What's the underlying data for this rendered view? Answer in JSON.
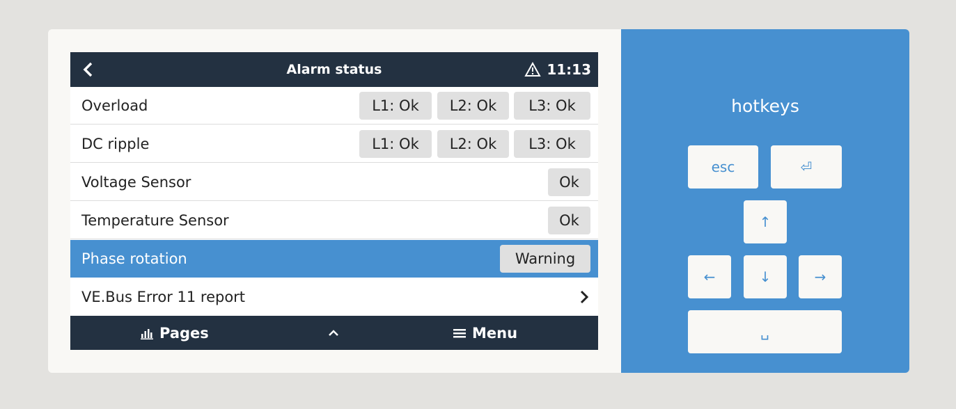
{
  "header": {
    "title": "Alarm status",
    "time": "11:13",
    "back_icon": "chevron-left-icon",
    "warning_icon": "warning-triangle-icon"
  },
  "rows": [
    {
      "label": "Overload",
      "pills": [
        "L1: Ok",
        "L2: Ok",
        "L3: Ok"
      ]
    },
    {
      "label": "DC ripple",
      "pills": [
        "L1: Ok",
        "L2: Ok",
        "L3: Ok"
      ]
    },
    {
      "label": "Voltage Sensor",
      "pills": [
        "Ok"
      ]
    },
    {
      "label": "Temperature Sensor",
      "pills": [
        "Ok"
      ]
    },
    {
      "label": "Phase rotation",
      "pills": [
        "Warning"
      ],
      "selected": true
    },
    {
      "label": "VE.Bus Error 11 report",
      "pills": [],
      "chevron": "chevron-right-icon"
    }
  ],
  "footer": {
    "pages_label": "Pages",
    "pages_icon": "bar-chart-icon",
    "up_icon": "chevron-up-icon",
    "menu_label": "Menu",
    "menu_icon": "hamburger-menu-icon"
  },
  "hotkeys": {
    "title": "hotkeys",
    "esc_label": "esc",
    "enter_glyph": "⏎",
    "up_glyph": "↑",
    "left_glyph": "←",
    "down_glyph": "↓",
    "right_glyph": "→",
    "space_glyph": "␣"
  },
  "colors": {
    "navy": "#233141",
    "accent_blue": "#4790d0",
    "background": "#e3e2df",
    "card": "#f9f8f5"
  }
}
